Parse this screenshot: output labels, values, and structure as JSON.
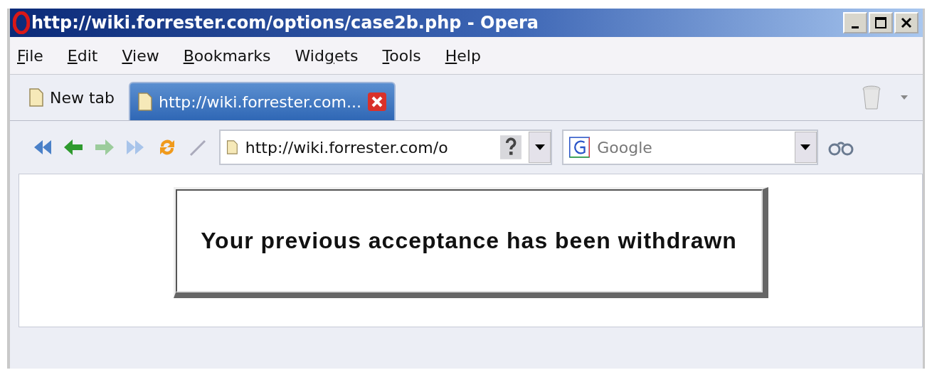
{
  "window": {
    "title": "http://wiki.forrester.com/options/case2b.php - Opera"
  },
  "menu": [
    {
      "access_key": "F",
      "after": "ile"
    },
    {
      "access_key": "E",
      "after": "dit"
    },
    {
      "access_key": "V",
      "after": "iew"
    },
    {
      "access_key": "B",
      "after": "ookmarks"
    },
    {
      "before": "Wid",
      "access_key": "g",
      "after": "ets"
    },
    {
      "access_key": "T",
      "after": "ools"
    },
    {
      "access_key": "H",
      "after": "elp"
    }
  ],
  "tabs": [
    {
      "label": "New tab",
      "selected": false
    },
    {
      "label": "http://wiki.forrester.com...",
      "selected": true
    }
  ],
  "address": {
    "value": "http://wiki.forrester.com/o"
  },
  "search": {
    "placeholder": "Google"
  },
  "page": {
    "message": "Your previous acceptance has been withdrawn"
  }
}
